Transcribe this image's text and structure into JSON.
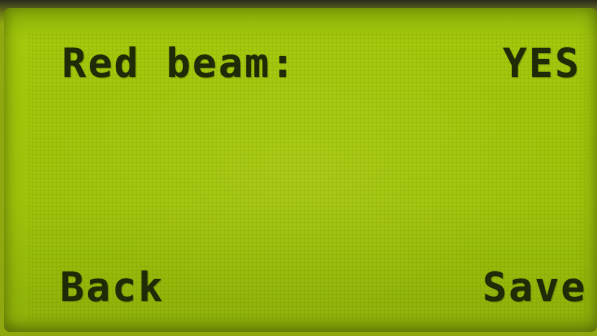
{
  "setting": {
    "label": "Red beam:",
    "value": "YES"
  },
  "softkeys": {
    "left": "Back",
    "right": "Save"
  },
  "colors": {
    "lcd_background": "#9fc30b",
    "lcd_text": "#1f2a06"
  }
}
